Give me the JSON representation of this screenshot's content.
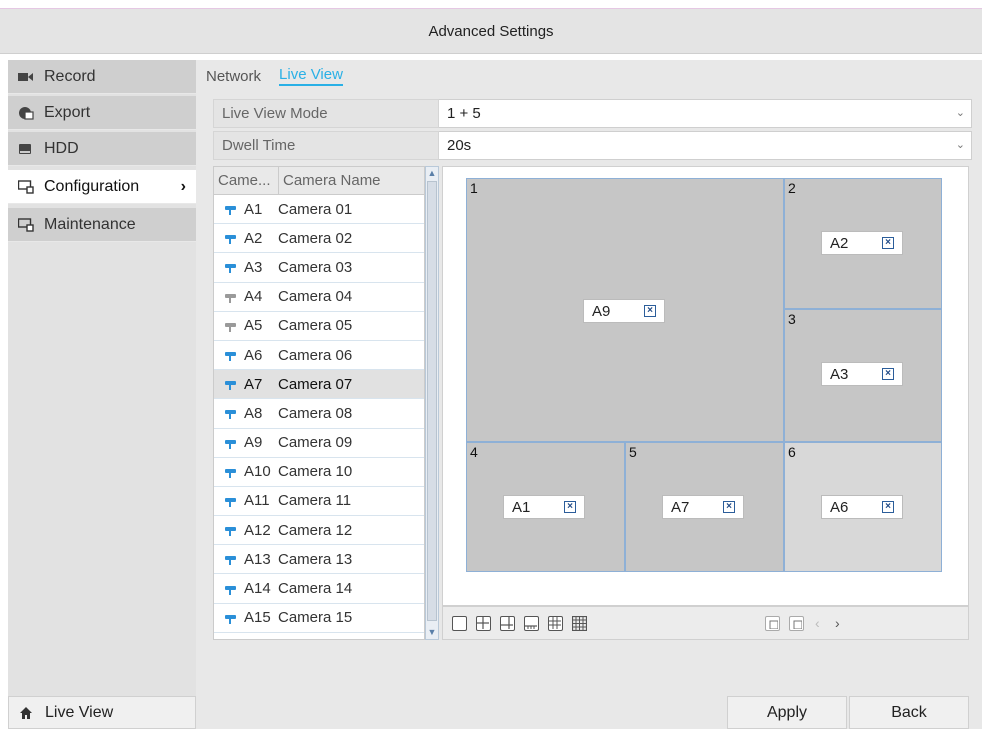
{
  "window": {
    "title": "Advanced Settings"
  },
  "sidebar": {
    "items": [
      {
        "label": "Record",
        "icon": "camcorder-icon"
      },
      {
        "label": "Export",
        "icon": "export-icon"
      },
      {
        "label": "HDD",
        "icon": "hdd-icon"
      },
      {
        "label": "Configuration",
        "icon": "config-icon",
        "active": true
      },
      {
        "label": "Maintenance",
        "icon": "maintenance-icon"
      }
    ],
    "live_view": {
      "label": "Live View",
      "icon": "home-icon"
    }
  },
  "tabs": [
    {
      "label": "Network"
    },
    {
      "label": "Live View",
      "active": true
    }
  ],
  "form": {
    "live_view_mode": {
      "label": "Live View Mode",
      "value": "1 + 5"
    },
    "dwell_time": {
      "label": "Dwell Time",
      "value": "20s"
    }
  },
  "camera_table": {
    "headers": [
      "Came...",
      "Camera Name"
    ],
    "rows": [
      {
        "id": "A1",
        "name": "Camera 01",
        "online": true
      },
      {
        "id": "A2",
        "name": "Camera 02",
        "online": true
      },
      {
        "id": "A3",
        "name": "Camera 03",
        "online": true
      },
      {
        "id": "A4",
        "name": "Camera 04",
        "online": false
      },
      {
        "id": "A5",
        "name": "Camera 05",
        "online": false
      },
      {
        "id": "A6",
        "name": "Camera 06",
        "online": true
      },
      {
        "id": "A7",
        "name": "Camera 07",
        "online": true,
        "selected": true
      },
      {
        "id": "A8",
        "name": "Camera 08",
        "online": true
      },
      {
        "id": "A9",
        "name": "Camera 09",
        "online": true
      },
      {
        "id": "A10",
        "name": "Camera 10",
        "online": true
      },
      {
        "id": "A11",
        "name": "Camera 11",
        "online": true
      },
      {
        "id": "A12",
        "name": "Camera 12",
        "online": true
      },
      {
        "id": "A13",
        "name": "Camera 13",
        "online": true
      },
      {
        "id": "A14",
        "name": "Camera 14",
        "online": true
      },
      {
        "id": "A15",
        "name": "Camera 15",
        "online": true
      }
    ]
  },
  "layout_windows": [
    {
      "number": "1",
      "camera": "A9"
    },
    {
      "number": "2",
      "camera": "A2"
    },
    {
      "number": "3",
      "camera": "A3"
    },
    {
      "number": "4",
      "camera": "A1"
    },
    {
      "number": "5",
      "camera": "A7"
    },
    {
      "number": "6",
      "camera": "A6"
    }
  ],
  "toolbar": {
    "layout_icons": [
      "layout-1-icon",
      "layout-4-icon",
      "layout-6-icon",
      "layout-8-icon",
      "layout-9-icon",
      "layout-16-icon"
    ],
    "prev_label": "‹",
    "next_label": "›"
  },
  "buttons": {
    "apply": "Apply",
    "back": "Back"
  },
  "colors": {
    "accent": "#2ab0e6",
    "camera_online": "#2a8fd8",
    "camera_offline": "#9a9a9a",
    "window_border": "#8eb0d6"
  }
}
